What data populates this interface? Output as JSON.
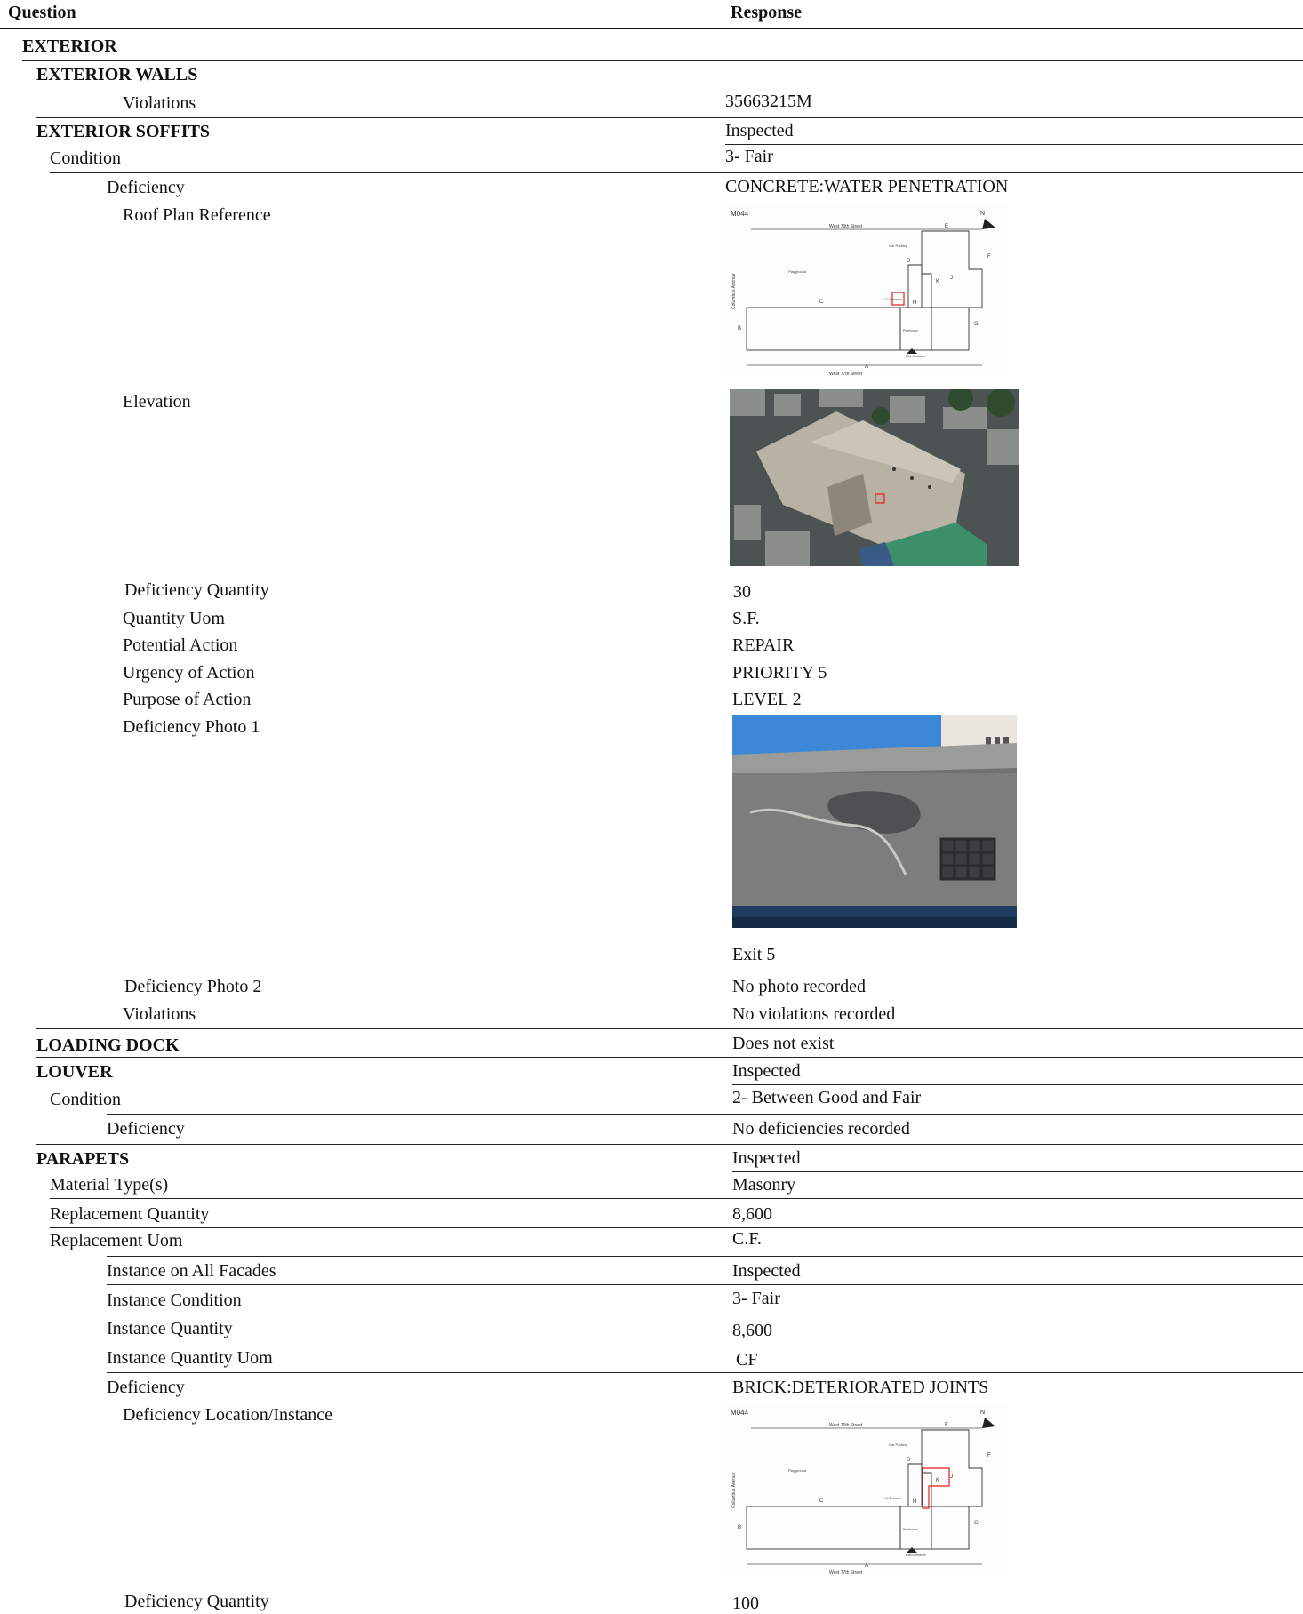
{
  "header": {
    "question": "Question",
    "response": "Response"
  },
  "rows": {
    "exterior": "EXTERIOR",
    "exterior_walls": "EXTERIOR WALLS",
    "ew_violations_q": "Violations",
    "ew_violations_a": "35663215M",
    "soffits_q": "EXTERIOR SOFFITS",
    "soffits_a": "Inspected",
    "soffits_condition_q": "Condition",
    "soffits_condition_a": "3- Fair",
    "soffits_def_q": "Deficiency",
    "soffits_def_a": "CONCRETE:WATER PENETRATION",
    "roof_plan_q": "Roof Plan Reference",
    "elevation_q": "Elevation",
    "def_qty_q": "Deficiency Quantity",
    "def_qty_a": "30",
    "qty_uom_q": "Quantity Uom",
    "qty_uom_a": "S.F.",
    "pot_action_q": "Potential Action",
    "pot_action_a": "REPAIR",
    "urgency_q": "Urgency of Action",
    "urgency_a": "PRIORITY 5",
    "purpose_q": "Purpose of Action",
    "purpose_a": "LEVEL 2",
    "photo1_q": "Deficiency Photo 1",
    "photo1_caption": "Exit 5",
    "photo2_q": "Deficiency Photo 2",
    "photo2_a": "No photo recorded",
    "soffits_viol_q": "Violations",
    "soffits_viol_a": "No violations recorded",
    "loading_q": "LOADING DOCK",
    "loading_a": "Does not exist",
    "louver_q": "LOUVER",
    "louver_a": "Inspected",
    "louver_cond_q": "Condition",
    "louver_cond_a": "2- Between Good and Fair",
    "louver_def_q": "Deficiency",
    "louver_def_a": "No deficiencies recorded",
    "parapets_q": "PARAPETS",
    "parapets_a": "Inspected",
    "material_q": "Material Type(s)",
    "material_a": "Masonry",
    "repl_qty_q": "Replacement Quantity",
    "repl_qty_a": "8,600",
    "repl_uom_q": "Replacement Uom",
    "repl_uom_a": "C.F.",
    "inst_all_q": "Instance on All Facades",
    "inst_all_a": "Inspected",
    "inst_cond_q": "Instance Condition",
    "inst_cond_a": "3- Fair",
    "inst_qty_q": "Instance Quantity",
    "inst_qty_a": "8,600",
    "inst_uom_q": "Instance Quantity Uom",
    "inst_uom_a": "CF",
    "par_def_q": "Deficiency",
    "par_def_a": "BRICK:DETERIORATED JOINTS",
    "def_loc_q": "Deficiency Location/Instance",
    "par_def_qty_q": "Deficiency Quantity",
    "par_def_qty_a": "100"
  },
  "plan": {
    "code": "M044",
    "north": "N",
    "street_top": "West 76th Street",
    "street_bottom": "West 77th Street",
    "avenue": "Columbus Avenue",
    "car_parking": "Car Parking",
    "playground": "Playground",
    "main_entrance": "Main Entrance",
    "penthouse": "Penthouse",
    "exit": "I-C Entrance",
    "labels": [
      "A",
      "B",
      "C",
      "D",
      "E",
      "F",
      "G",
      "H",
      "J",
      "K"
    ]
  }
}
